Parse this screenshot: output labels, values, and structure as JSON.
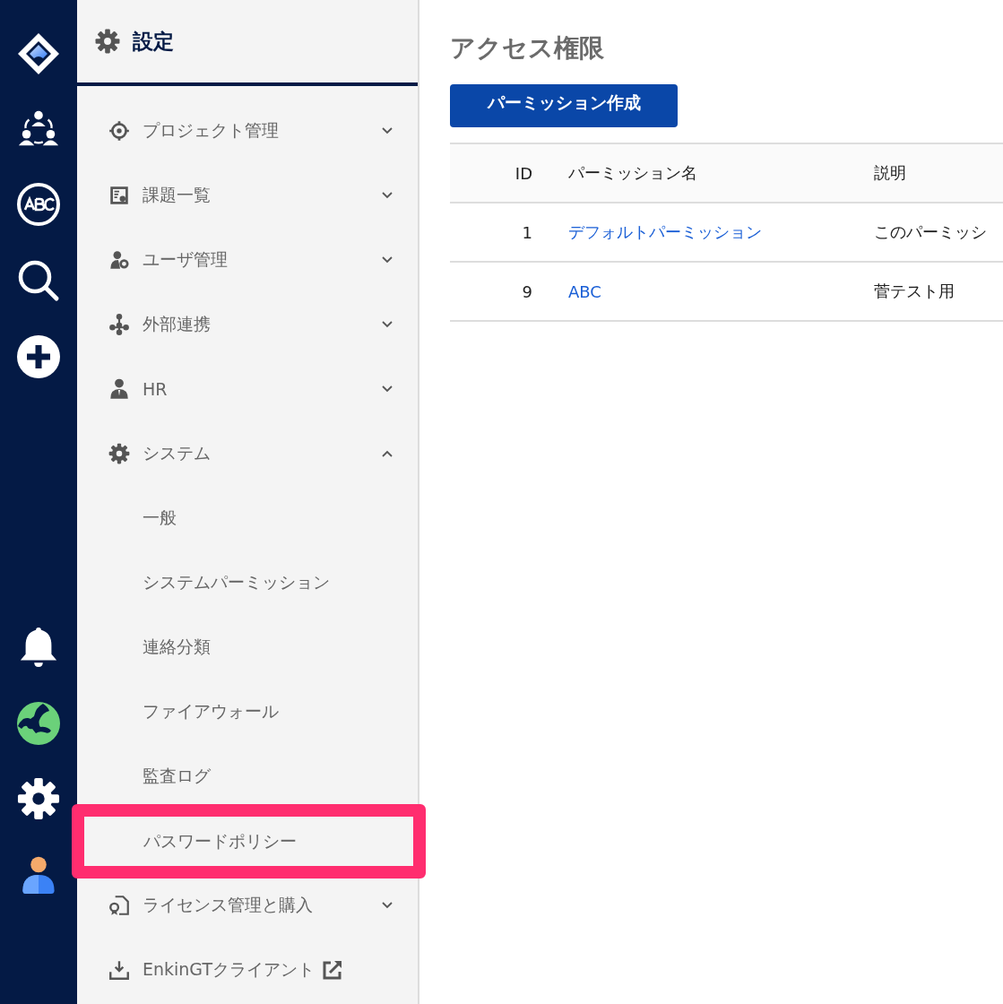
{
  "sidebar": {
    "title": "設定",
    "items": [
      {
        "label": "プロジェクト管理",
        "expanded": false
      },
      {
        "label": "課題一覧",
        "expanded": false
      },
      {
        "label": "ユーザ管理",
        "expanded": false
      },
      {
        "label": "外部連携",
        "expanded": false
      },
      {
        "label": "HR",
        "expanded": false
      },
      {
        "label": "システム",
        "expanded": true,
        "children": [
          {
            "label": "一般",
            "highlighted": false
          },
          {
            "label": "システムパーミッション",
            "highlighted": false
          },
          {
            "label": "連絡分類",
            "highlighted": false
          },
          {
            "label": "ファイアウォール",
            "highlighted": false
          },
          {
            "label": "監査ログ",
            "highlighted": false
          },
          {
            "label": "パスワードポリシー",
            "highlighted": true
          }
        ]
      },
      {
        "label": "ライセンス管理と購入",
        "expanded": false
      },
      {
        "label": "EnkinGTクライアント",
        "external": true
      }
    ]
  },
  "main": {
    "title": "アクセス権限",
    "create_button": "パーミッション作成",
    "table": {
      "columns": [
        "ID",
        "パーミッション名",
        "説明"
      ],
      "rows": [
        {
          "id": "1",
          "name": "デフォルトパーミッション",
          "description": "このパーミッシ"
        },
        {
          "id": "9",
          "name": "ABC",
          "description": "菅テスト用"
        }
      ]
    }
  }
}
